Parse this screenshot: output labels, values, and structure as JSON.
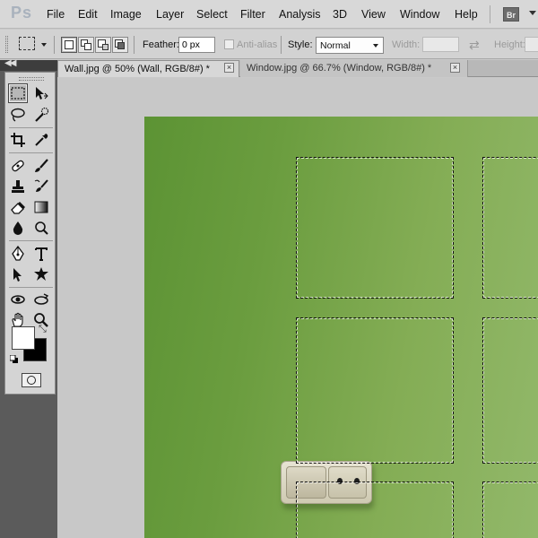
{
  "app": {
    "logo": "Ps",
    "bridge_button": "Br",
    "menu": [
      "File",
      "Edit",
      "Image",
      "Layer",
      "Select",
      "Filter",
      "Analysis",
      "3D",
      "View",
      "Window",
      "Help"
    ]
  },
  "options_bar": {
    "feather_label": "Feather:",
    "feather_value": "0 px",
    "anti_alias_label": "Anti-alias",
    "style_label": "Style:",
    "style_value": "Normal",
    "width_label": "Width:",
    "height_label": "Height:"
  },
  "tabs": [
    {
      "label": "Wall.jpg @ 50% (Wall, RGB/8#) *",
      "active": true
    },
    {
      "label": "Window.jpg @ 66.7% (Window, RGB/8#) *",
      "active": false
    }
  ],
  "toolbox": {
    "collapse_glyph": "◀◀",
    "tools": [
      "rectangular-marquee",
      "move",
      "lasso",
      "quick-selection",
      "crop",
      "eyedropper",
      "spot-healing-brush",
      "brush",
      "clone-stamp",
      "history-brush",
      "eraser",
      "gradient",
      "blur",
      "dodge",
      "pen",
      "type",
      "path-selection",
      "custom-shape",
      "3d-rotate",
      "3d-orbit",
      "hand",
      "zoom"
    ],
    "foreground_color": "#ffffff",
    "background_color": "#000000"
  },
  "canvas": {
    "document_color_start": "#5c9334",
    "document_color_end": "#92b86a"
  }
}
